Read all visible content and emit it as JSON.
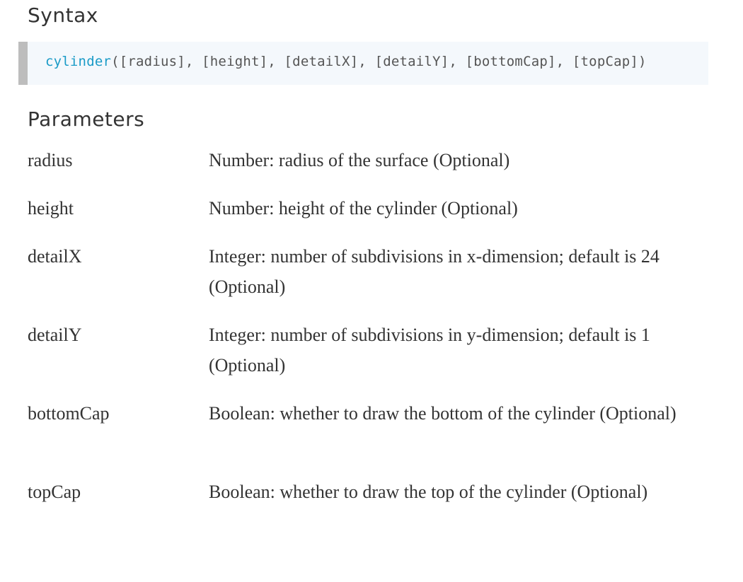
{
  "syntax": {
    "heading": "Syntax",
    "function_name": "cylinder",
    "signature_rest": "([radius], [height], [detailX], [detailY], [bottomCap], [topCap])"
  },
  "parameters": {
    "heading": "Parameters",
    "items": [
      {
        "name": "radius",
        "description": "Number: radius of the surface (Optional)"
      },
      {
        "name": "height",
        "description": "Number: height of the cylinder (Optional)"
      },
      {
        "name": "detailX",
        "description": "Integer: number of subdivisions in x-dimension; default is 24 (Optional)"
      },
      {
        "name": "detailY",
        "description": "Integer: number of subdivisions in y-dimension; default is 1 (Optional)"
      },
      {
        "name": "bottomCap",
        "description": "Boolean: whether to draw the bottom of the cylinder (Optional)"
      },
      {
        "name": "topCap",
        "description": "Boolean: whether to draw the top of the cylinder (Optional)"
      }
    ]
  }
}
